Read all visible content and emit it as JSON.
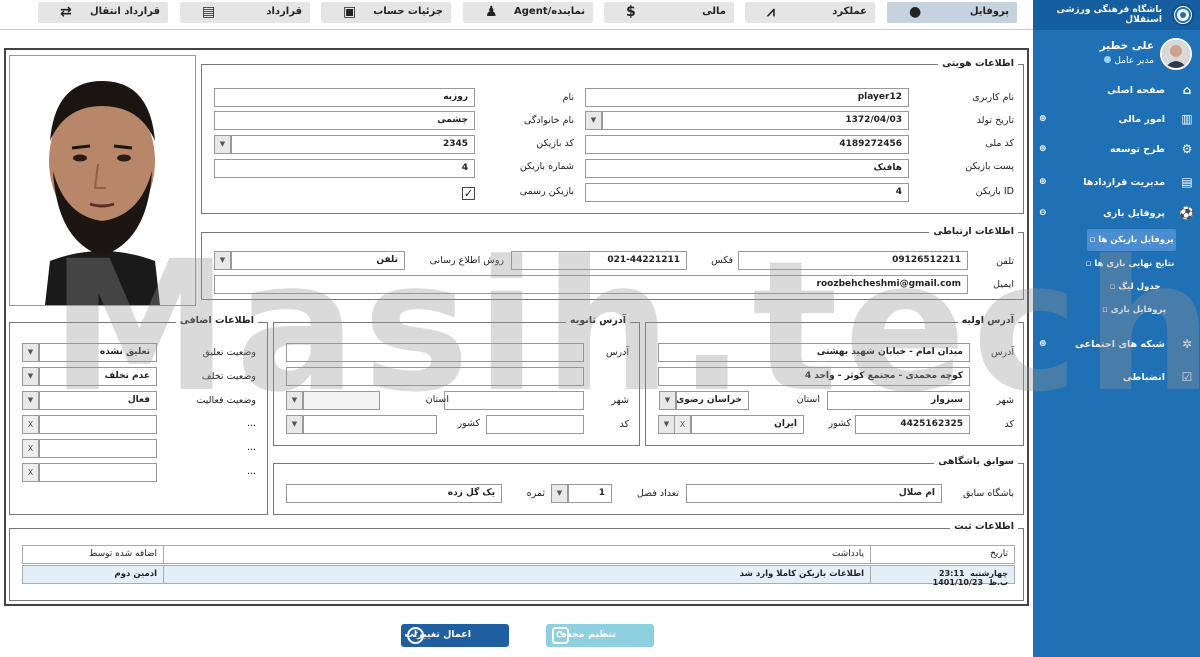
{
  "sidebar": {
    "org_title": "باشگاه فرهنگی ورزشی استقلال",
    "user_name": "علی خطیر",
    "user_role": "مدیر عامل",
    "items": [
      {
        "label": "صفحه اصلی",
        "icon": "home-icon"
      },
      {
        "label": "امور مالی",
        "icon": "chart-icon"
      },
      {
        "label": "طرح توسعه",
        "icon": "gear-icon"
      },
      {
        "label": "مدیریت قراردادها",
        "icon": "contract-icon"
      },
      {
        "label": "پروفایل بازی",
        "icon": "ball-icon"
      },
      {
        "label": "شبکه های اجتماعی",
        "icon": "network-icon"
      },
      {
        "label": "انضباطی",
        "icon": "discipline-icon"
      }
    ],
    "sub_items": [
      "پروفایل بازیکن ها",
      "نتایج نهایی بازی ها",
      "جدول لیگ",
      "پروفایل بازی"
    ]
  },
  "tabs": [
    {
      "label": "پروفایل",
      "icon": "person-icon"
    },
    {
      "label": "عملکرد",
      "icon": "performance-icon"
    },
    {
      "label": "مالی",
      "icon": "dollar-icon"
    },
    {
      "label": "نماینده/Agent",
      "icon": "agent-icon"
    },
    {
      "label": "جزئیات حساب",
      "icon": "wallet-icon"
    },
    {
      "label": "قرارداد",
      "icon": "document-icon"
    },
    {
      "label": "قرارداد انتقال",
      "icon": "transfer-icon"
    }
  ],
  "identity": {
    "title": "اطلاعات هویتی",
    "username_label": "نام کاربری",
    "username": "player12",
    "first_name_label": "نام",
    "first_name": "روزبه",
    "birth_label": "تاریخ تولد",
    "birth": "1372/04/03",
    "last_name_label": "نام خانوادگی",
    "last_name": "چشمی",
    "national_label": "کد ملی",
    "national": "4189272456",
    "player_code_label": "کد بازیکن",
    "player_code": "2345",
    "position_label": "پست بازیکن",
    "position": "هافبک",
    "number_label": "شماره بازیکن",
    "number": "4",
    "id_label": "ID بازیکن",
    "id": "4",
    "official_label": "بازیکن رسمی",
    "official_check": "✓"
  },
  "contact": {
    "title": "اطلاعات ارتباطی",
    "phone_label": "تلفن",
    "phone": "09126512211",
    "fax_label": "فکس",
    "fax": "021-44221211",
    "notify_label": "روش اطلاع رسانی",
    "notify": "تلفن",
    "email_label": "ایمیل",
    "email": "roozbehcheshmi@gmail.com"
  },
  "primary_address": {
    "title": "آدرس اولیه",
    "address_label": "آدرس",
    "line1": "میدان امام - خیابان شهید بهشتی",
    "line2": "کوچه محمدی - مجتمع کوثر - واحد 4",
    "city_label": "شهر",
    "city": "سبزوار",
    "province_label": "استان",
    "province": "خراسان رضوی",
    "postal_label": "کد",
    "postal": "4425162325",
    "country_label": "کشور",
    "country": "ایران",
    "clear": "X"
  },
  "secondary_address": {
    "title": "آدرس ثانویه",
    "address_label": "آدرس",
    "city_label": "شهر",
    "province_label": "استان",
    "postal_label": "کد",
    "country_label": "کشور"
  },
  "extra": {
    "title": "اطلاعات اضافی",
    "suspension_label": "وضعیت تعلیق",
    "suspension": "تعلیق نشده",
    "violation_label": "وضعیت تخلف",
    "violation": "عدم تخلف",
    "activity_label": "وضعیت فعالیت",
    "activity": "فعال",
    "more": "...",
    "clear": "X"
  },
  "club_history": {
    "title": "سوابق باشگاهی",
    "prev_club_label": "باشگاه سابق",
    "prev_club": "ام صلال",
    "seasons_label": "تعداد فصل",
    "seasons": "1",
    "result_label": "ثمره",
    "result": "یک گل زده"
  },
  "registration": {
    "title": "اطلاعات ثبت",
    "columns": [
      "تاریخ",
      "یادداشت",
      "اضافه شده توسط"
    ],
    "row": {
      "day": "چهارشنبه",
      "time": "23:11 ب.ظ",
      "date": "1401/10/23",
      "note": "اطلاعات بازیکن کاملا وارد شد",
      "added_by": "ادمین دوم"
    }
  },
  "buttons": {
    "apply": "اعمال تغییرات",
    "reset": "تنظیم مجدد"
  },
  "watermark": "Masih.tech",
  "colors": {
    "sidebar": "#1f70b5",
    "apply_button": "#1f5f9f",
    "reset_button": "#8fd0e0"
  }
}
